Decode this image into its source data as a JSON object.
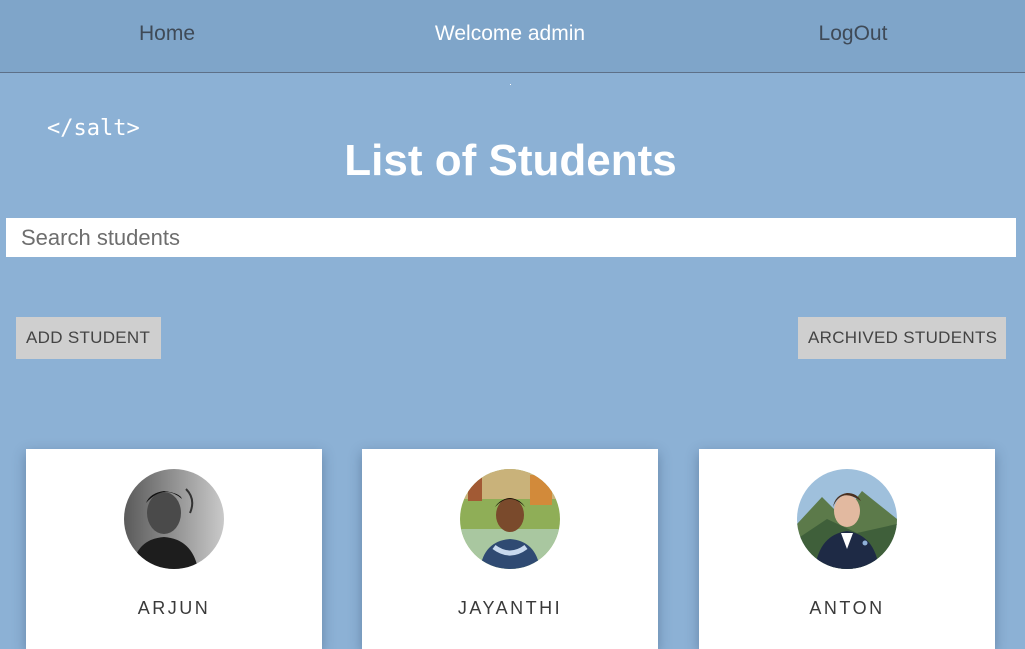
{
  "nav": {
    "home": "Home",
    "welcome": "Welcome admin",
    "logout": "LogOut"
  },
  "logo": "</salt>",
  "page_title": "List of Students",
  "search": {
    "placeholder": "Search students",
    "value": ""
  },
  "buttons": {
    "add_student": "ADD STUDENT",
    "archived_students": "ARCHIVED STUDENTS"
  },
  "students": [
    {
      "name": "ARJUN",
      "avatar": "photo-grayscale-man"
    },
    {
      "name": "JAYANTHI",
      "avatar": "photo-woman-outdoors"
    },
    {
      "name": "ANTON",
      "avatar": "photo-man-mountains"
    }
  ],
  "colors": {
    "background": "#8cb1d5",
    "navbar": "#7fa5c9",
    "button": "#cfcfcf",
    "card": "#ffffff"
  }
}
